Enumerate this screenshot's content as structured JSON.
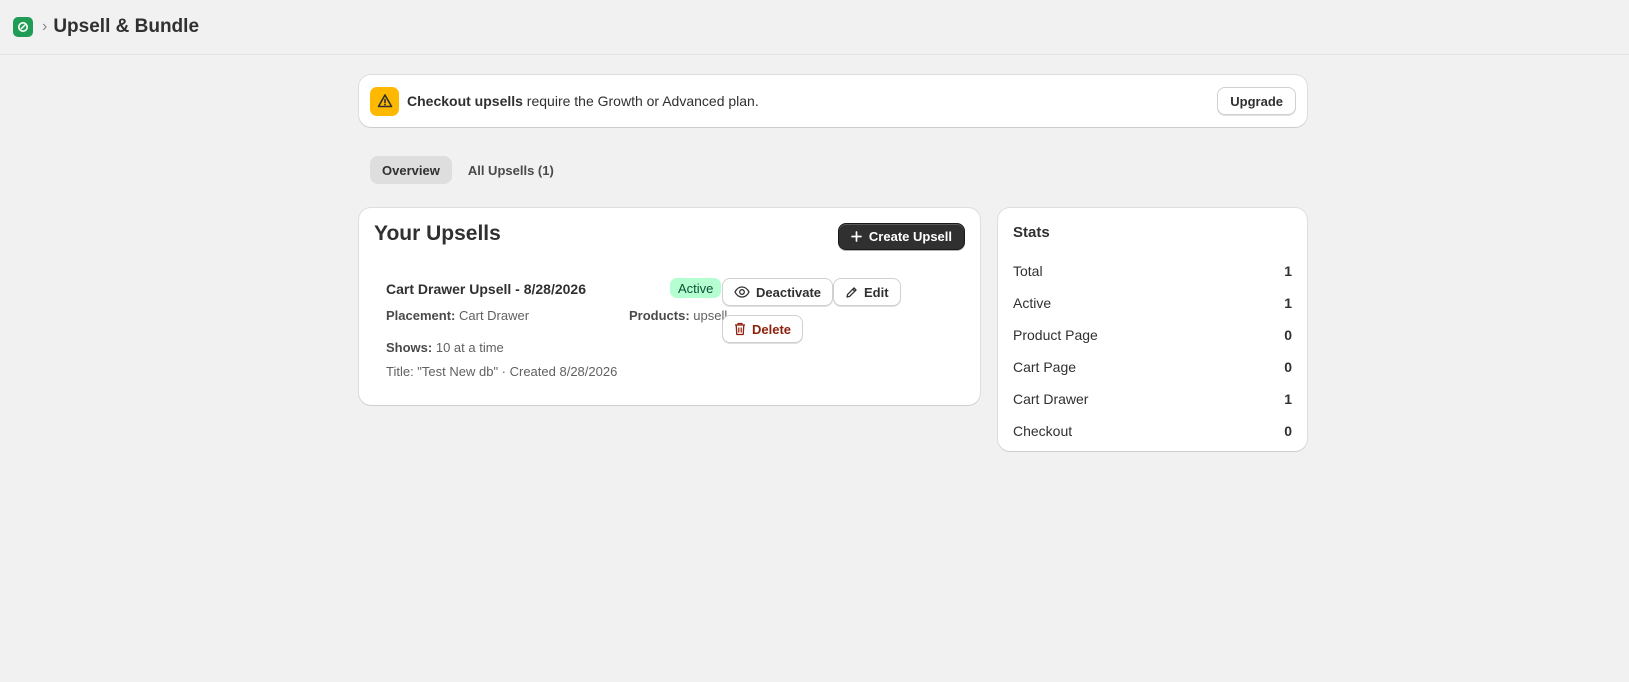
{
  "header": {
    "title": "Upsell & Bundle",
    "breadcrumb_separator": "›"
  },
  "banner": {
    "bold_text": "Checkout upsells",
    "text": " require the Growth or Advanced plan.",
    "button_label": "Upgrade"
  },
  "tabs": [
    {
      "label": "Overview",
      "active": true
    },
    {
      "label": "All Upsells (1)",
      "active": false
    }
  ],
  "upsells": {
    "title": "Your Upsells",
    "create_label": "Create Upsell",
    "items": [
      {
        "name": "Cart Drawer Upsell - 8/28/2026",
        "status": "Active",
        "placement_label": "Placement:",
        "placement_value": "Cart Drawer",
        "products_label": "Products:",
        "products_value": "upsell",
        "shows_label": "Shows:",
        "shows_value": "10 at a time",
        "subline": "Title: \"Test New db\" · Created 8/28/2026",
        "deactivate_label": "Deactivate",
        "edit_label": "Edit",
        "delete_label": "Delete"
      }
    ]
  },
  "stats": {
    "title": "Stats",
    "rows": [
      {
        "label": "Total",
        "value": "1"
      },
      {
        "label": "Active",
        "value": "1"
      },
      {
        "label": "Product Page",
        "value": "0"
      },
      {
        "label": "Cart Page",
        "value": "0"
      },
      {
        "label": "Cart Drawer",
        "value": "1"
      },
      {
        "label": "Checkout",
        "value": "0"
      }
    ]
  },
  "colors": {
    "app_icon": "#1f9d55",
    "warning": "#ffb800",
    "active_badge_bg": "#b4fed2",
    "active_badge_text": "#0c5132",
    "primary_button": "#303030",
    "delete_text": "#8e1f0b"
  },
  "icons": {
    "app": "app-logo-icon",
    "warning": "warning-triangle-icon",
    "create": "plus-icon",
    "deactivate": "eye-icon",
    "edit": "pencil-icon",
    "delete": "trash-icon"
  }
}
